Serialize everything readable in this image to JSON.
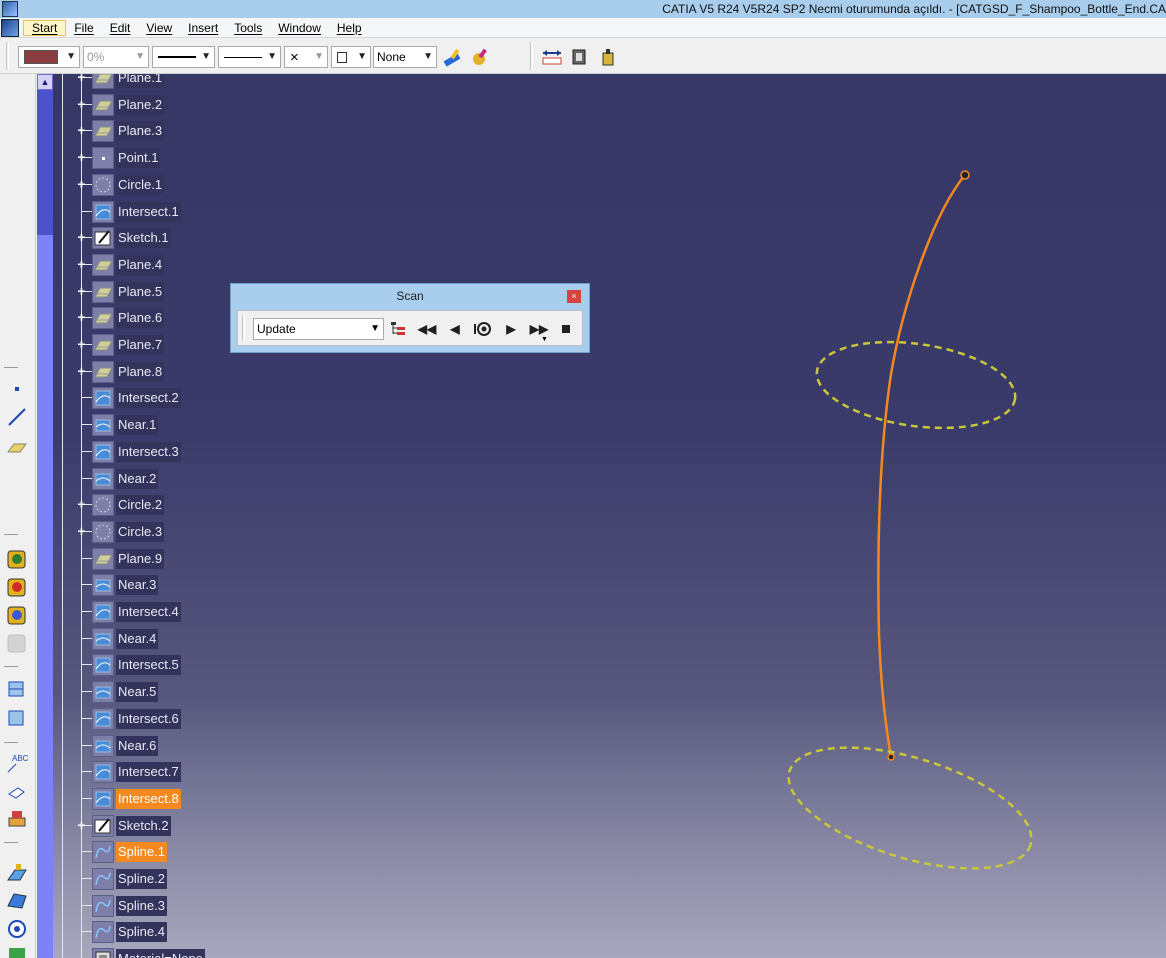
{
  "window": {
    "title": "CATIA V5 R24 V5R24 SP2 Necmi oturumunda açıldı. - [CATGSD_F_Shampoo_Bottle_End.CA"
  },
  "menu": {
    "items": [
      "Start",
      "File",
      "Edit",
      "View",
      "Insert",
      "Tools",
      "Window",
      "Help"
    ]
  },
  "toolbar": {
    "fill_color": "#8a3e3e",
    "transparency": "0%",
    "line_style_value": "",
    "line_type_value": "",
    "symbol_value": "×",
    "layer_value": "None"
  },
  "tree": {
    "nodes": [
      {
        "label": "Plane.1",
        "icon": "plane-icon",
        "expandable": true,
        "selected": false
      },
      {
        "label": "Plane.2",
        "icon": "plane-icon",
        "expandable": true,
        "selected": false
      },
      {
        "label": "Plane.3",
        "icon": "plane-icon",
        "expandable": true,
        "selected": false
      },
      {
        "label": "Point.1",
        "icon": "point-icon",
        "expandable": true,
        "selected": false
      },
      {
        "label": "Circle.1",
        "icon": "circle-icon",
        "expandable": true,
        "selected": false
      },
      {
        "label": "Intersect.1",
        "icon": "intersect-icon",
        "expandable": false,
        "selected": false
      },
      {
        "label": "Sketch.1",
        "icon": "sketch-icon",
        "expandable": true,
        "selected": false
      },
      {
        "label": "Plane.4",
        "icon": "plane-icon",
        "expandable": true,
        "selected": false
      },
      {
        "label": "Plane.5",
        "icon": "plane-icon",
        "expandable": true,
        "selected": false
      },
      {
        "label": "Plane.6",
        "icon": "plane-icon",
        "expandable": true,
        "selected": false
      },
      {
        "label": "Plane.7",
        "icon": "plane-icon",
        "expandable": true,
        "selected": false
      },
      {
        "label": "Plane.8",
        "icon": "plane-icon",
        "expandable": true,
        "selected": false
      },
      {
        "label": "Intersect.2",
        "icon": "intersect-icon",
        "expandable": false,
        "selected": false
      },
      {
        "label": "Near.1",
        "icon": "near-icon",
        "expandable": false,
        "selected": false
      },
      {
        "label": "Intersect.3",
        "icon": "intersect-icon",
        "expandable": false,
        "selected": false
      },
      {
        "label": "Near.2",
        "icon": "near-icon",
        "expandable": false,
        "selected": false
      },
      {
        "label": "Circle.2",
        "icon": "circle-icon",
        "expandable": true,
        "selected": false
      },
      {
        "label": "Circle.3",
        "icon": "circle-icon",
        "expandable": true,
        "selected": false
      },
      {
        "label": "Plane.9",
        "icon": "plane-icon",
        "expandable": false,
        "selected": false
      },
      {
        "label": "Near.3",
        "icon": "near-icon",
        "expandable": false,
        "selected": false
      },
      {
        "label": "Intersect.4",
        "icon": "intersect-icon",
        "expandable": false,
        "selected": false
      },
      {
        "label": "Near.4",
        "icon": "near-icon",
        "expandable": false,
        "selected": false
      },
      {
        "label": "Intersect.5",
        "icon": "intersect-icon",
        "expandable": false,
        "selected": false
      },
      {
        "label": "Near.5",
        "icon": "near-icon",
        "expandable": false,
        "selected": false
      },
      {
        "label": "Intersect.6",
        "icon": "intersect-icon",
        "expandable": false,
        "selected": false
      },
      {
        "label": "Near.6",
        "icon": "near-icon",
        "expandable": false,
        "selected": false
      },
      {
        "label": "Intersect.7",
        "icon": "intersect-icon",
        "expandable": false,
        "selected": false
      },
      {
        "label": "Intersect.8",
        "icon": "intersect-icon",
        "expandable": false,
        "selected": true
      },
      {
        "label": "Sketch.2",
        "icon": "sketch-icon",
        "expandable": true,
        "selected": false
      },
      {
        "label": "Spline.1",
        "icon": "spline-icon",
        "expandable": false,
        "selected": true
      },
      {
        "label": "Spline.2",
        "icon": "spline-icon",
        "expandable": false,
        "selected": false
      },
      {
        "label": "Spline.3",
        "icon": "spline-icon",
        "expandable": false,
        "selected": false
      },
      {
        "label": "Spline.4",
        "icon": "spline-icon",
        "expandable": false,
        "selected": false
      },
      {
        "label": "Material=None",
        "icon": "material-icon",
        "expandable": false,
        "selected": false
      }
    ]
  },
  "scan": {
    "title": "Scan",
    "close_label": "×",
    "mode_value": "Update",
    "buttons": [
      "graph-icon",
      "first-icon",
      "previous-icon",
      "step-icon",
      "next-icon",
      "last-icon",
      "stop-icon"
    ]
  },
  "colors": {
    "accent_selected": "#f3891f",
    "spline_curve": "#f3891f",
    "circle_dashed": "#c8c83a"
  }
}
